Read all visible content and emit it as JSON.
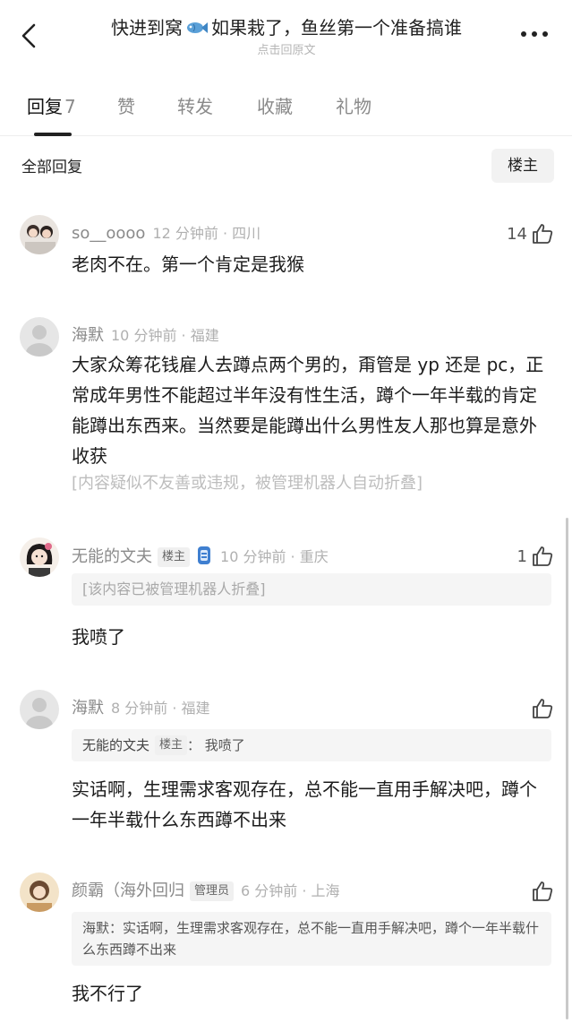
{
  "header": {
    "title_before": "快进到窝",
    "title_after": "如果栽了，鱼丝第一个准备搞谁",
    "subtitle": "点击回原文",
    "fish_icon": "fish-emoji"
  },
  "tabs": [
    {
      "label": "回复",
      "count": "7"
    },
    {
      "label": "赞"
    },
    {
      "label": "转发"
    },
    {
      "label": "收藏"
    },
    {
      "label": "礼物"
    }
  ],
  "filter": {
    "label": "全部回复",
    "owner_button": "楼主"
  },
  "comments": [
    {
      "user": "so__oooo",
      "time": "12 分钟前 · 四川",
      "likes": "14",
      "body": "老肉不在。第一个肯定是我猴"
    },
    {
      "user": "海默",
      "time": "10 分钟前 · 福建",
      "body": "大家众筹花钱雇人去蹲点两个男的，甭管是 yp 还是 pc，正常成年男性不能超过半年没有性生活，蹲个一年半载的肯定能蹲出东西来。当然要是能蹲出什么男性友人那也算是意外收获",
      "folded": "[内容疑似不友善或违规，被管理机器人自动折叠]"
    },
    {
      "user": "无能的文夫",
      "tag": "楼主",
      "time": "10 分钟前 · 重庆",
      "likes": "1",
      "quote": "[该内容已被管理机器人折叠]",
      "body": "我喷了"
    },
    {
      "user": "海默",
      "time": "8 分钟前 · 福建",
      "quote_name": "无能的文夫",
      "quote_tag": "楼主",
      "quote_text": "：  我喷了",
      "body": "实话啊，生理需求客观存在，总不能一直用手解决吧，蹲个一年半载什么东西蹲不出来"
    },
    {
      "user": "颜霸（海外回归",
      "tag": "管理员",
      "time": "6 分钟前 · 上海",
      "quote": "海默：实话啊，生理需求客观存在，总不能一直用手解决吧，蹲个一年半载什么东西蹲不出来",
      "body": "我不行了"
    }
  ]
}
